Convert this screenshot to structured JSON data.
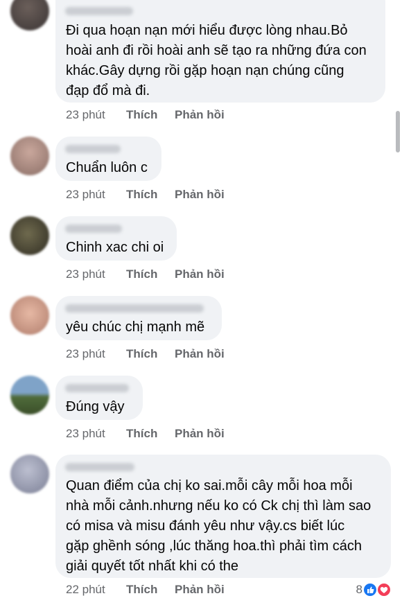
{
  "comments": [
    {
      "text": "Đi qua hoạn nạn mới hiểu được lòng nhau.Bỏ\nhoài anh đi rồi hoài anh sẽ tạo ra những đứa con\nkhác.Gây dựng rồi gặp hoạn nạn chúng cũng\nđạp đổ mà đi.",
      "time": "23 phút",
      "like": "Thích",
      "reply": "Phản hồi"
    },
    {
      "text": "Chuẩn luôn c",
      "time": "23 phút",
      "like": "Thích",
      "reply": "Phản hồi"
    },
    {
      "text": "Chinh xac chi oi",
      "time": "23 phút",
      "like": "Thích",
      "reply": "Phản hồi"
    },
    {
      "text": "yêu chúc chị mạnh mẽ",
      "time": "23 phút",
      "like": "Thích",
      "reply": "Phản hồi"
    },
    {
      "text": "Đúng vậy",
      "time": "23 phút",
      "like": "Thích",
      "reply": "Phản hồi"
    },
    {
      "text": "Quan điểm của chị ko sai.mỗi cây mỗi hoa mỗi\nnhà mỗi cảnh.nhưng nếu ko có Ck chị thì làm sao\ncó misa và misu đánh yêu như vậy.cs biết lúc\ngặp ghềnh sóng ,lúc thăng hoa.thì phải tìm cách\ngiải quyết tốt nhất khi có the",
      "time": "22 phút",
      "like": "Thích",
      "reply": "Phản hồi",
      "reaction_count": "8",
      "reaction_icons": [
        "like-icon",
        "love-icon"
      ]
    }
  ],
  "colors": {
    "bubble": "#f0f2f5",
    "meta_text": "#65676b",
    "like_blue": "#1877f2",
    "love_red": "#f33e58"
  }
}
